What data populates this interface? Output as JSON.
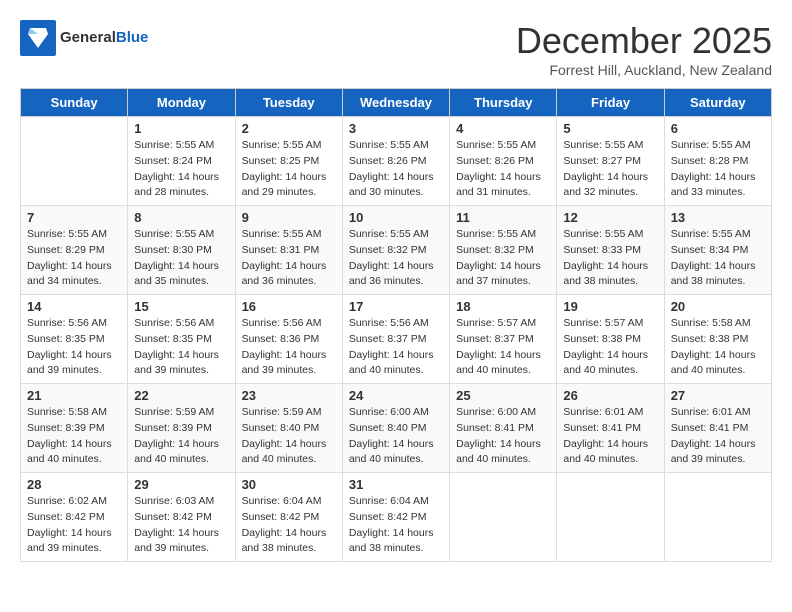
{
  "header": {
    "logo": {
      "general": "General",
      "blue": "Blue"
    },
    "title": "December 2025",
    "location": "Forrest Hill, Auckland, New Zealand"
  },
  "days_of_week": [
    "Sunday",
    "Monday",
    "Tuesday",
    "Wednesday",
    "Thursday",
    "Friday",
    "Saturday"
  ],
  "weeks": [
    [
      {
        "day": "",
        "sunrise": "",
        "sunset": "",
        "daylight": ""
      },
      {
        "day": "1",
        "sunrise": "5:55 AM",
        "sunset": "8:24 PM",
        "daylight": "14 hours and 28 minutes."
      },
      {
        "day": "2",
        "sunrise": "5:55 AM",
        "sunset": "8:25 PM",
        "daylight": "14 hours and 29 minutes."
      },
      {
        "day": "3",
        "sunrise": "5:55 AM",
        "sunset": "8:26 PM",
        "daylight": "14 hours and 30 minutes."
      },
      {
        "day": "4",
        "sunrise": "5:55 AM",
        "sunset": "8:26 PM",
        "daylight": "14 hours and 31 minutes."
      },
      {
        "day": "5",
        "sunrise": "5:55 AM",
        "sunset": "8:27 PM",
        "daylight": "14 hours and 32 minutes."
      },
      {
        "day": "6",
        "sunrise": "5:55 AM",
        "sunset": "8:28 PM",
        "daylight": "14 hours and 33 minutes."
      }
    ],
    [
      {
        "day": "7",
        "sunrise": "5:55 AM",
        "sunset": "8:29 PM",
        "daylight": "14 hours and 34 minutes."
      },
      {
        "day": "8",
        "sunrise": "5:55 AM",
        "sunset": "8:30 PM",
        "daylight": "14 hours and 35 minutes."
      },
      {
        "day": "9",
        "sunrise": "5:55 AM",
        "sunset": "8:31 PM",
        "daylight": "14 hours and 36 minutes."
      },
      {
        "day": "10",
        "sunrise": "5:55 AM",
        "sunset": "8:32 PM",
        "daylight": "14 hours and 36 minutes."
      },
      {
        "day": "11",
        "sunrise": "5:55 AM",
        "sunset": "8:32 PM",
        "daylight": "14 hours and 37 minutes."
      },
      {
        "day": "12",
        "sunrise": "5:55 AM",
        "sunset": "8:33 PM",
        "daylight": "14 hours and 38 minutes."
      },
      {
        "day": "13",
        "sunrise": "5:55 AM",
        "sunset": "8:34 PM",
        "daylight": "14 hours and 38 minutes."
      }
    ],
    [
      {
        "day": "14",
        "sunrise": "5:56 AM",
        "sunset": "8:35 PM",
        "daylight": "14 hours and 39 minutes."
      },
      {
        "day": "15",
        "sunrise": "5:56 AM",
        "sunset": "8:35 PM",
        "daylight": "14 hours and 39 minutes."
      },
      {
        "day": "16",
        "sunrise": "5:56 AM",
        "sunset": "8:36 PM",
        "daylight": "14 hours and 39 minutes."
      },
      {
        "day": "17",
        "sunrise": "5:56 AM",
        "sunset": "8:37 PM",
        "daylight": "14 hours and 40 minutes."
      },
      {
        "day": "18",
        "sunrise": "5:57 AM",
        "sunset": "8:37 PM",
        "daylight": "14 hours and 40 minutes."
      },
      {
        "day": "19",
        "sunrise": "5:57 AM",
        "sunset": "8:38 PM",
        "daylight": "14 hours and 40 minutes."
      },
      {
        "day": "20",
        "sunrise": "5:58 AM",
        "sunset": "8:38 PM",
        "daylight": "14 hours and 40 minutes."
      }
    ],
    [
      {
        "day": "21",
        "sunrise": "5:58 AM",
        "sunset": "8:39 PM",
        "daylight": "14 hours and 40 minutes."
      },
      {
        "day": "22",
        "sunrise": "5:59 AM",
        "sunset": "8:39 PM",
        "daylight": "14 hours and 40 minutes."
      },
      {
        "day": "23",
        "sunrise": "5:59 AM",
        "sunset": "8:40 PM",
        "daylight": "14 hours and 40 minutes."
      },
      {
        "day": "24",
        "sunrise": "6:00 AM",
        "sunset": "8:40 PM",
        "daylight": "14 hours and 40 minutes."
      },
      {
        "day": "25",
        "sunrise": "6:00 AM",
        "sunset": "8:41 PM",
        "daylight": "14 hours and 40 minutes."
      },
      {
        "day": "26",
        "sunrise": "6:01 AM",
        "sunset": "8:41 PM",
        "daylight": "14 hours and 40 minutes."
      },
      {
        "day": "27",
        "sunrise": "6:01 AM",
        "sunset": "8:41 PM",
        "daylight": "14 hours and 39 minutes."
      }
    ],
    [
      {
        "day": "28",
        "sunrise": "6:02 AM",
        "sunset": "8:42 PM",
        "daylight": "14 hours and 39 minutes."
      },
      {
        "day": "29",
        "sunrise": "6:03 AM",
        "sunset": "8:42 PM",
        "daylight": "14 hours and 39 minutes."
      },
      {
        "day": "30",
        "sunrise": "6:04 AM",
        "sunset": "8:42 PM",
        "daylight": "14 hours and 38 minutes."
      },
      {
        "day": "31",
        "sunrise": "6:04 AM",
        "sunset": "8:42 PM",
        "daylight": "14 hours and 38 minutes."
      },
      {
        "day": "",
        "sunrise": "",
        "sunset": "",
        "daylight": ""
      },
      {
        "day": "",
        "sunrise": "",
        "sunset": "",
        "daylight": ""
      },
      {
        "day": "",
        "sunrise": "",
        "sunset": "",
        "daylight": ""
      }
    ]
  ]
}
